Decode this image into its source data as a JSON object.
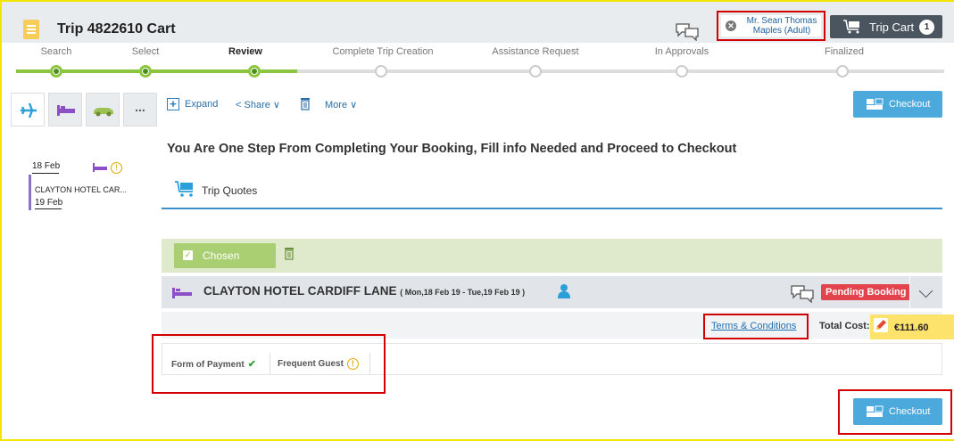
{
  "header": {
    "title": "Trip 4822610 Cart",
    "user_line1": "Mr. Sean Thomas",
    "user_line2": "Maples (Adult)",
    "cart_label": "Trip Cart",
    "cart_count": "1"
  },
  "steps": [
    {
      "label": "Search",
      "state": "done"
    },
    {
      "label": "Select",
      "state": "done"
    },
    {
      "label": "Review",
      "state": "current"
    },
    {
      "label": "Complete Trip Creation",
      "state": "todo"
    },
    {
      "label": "Assistance Request",
      "state": "todo"
    },
    {
      "label": "In Approvals",
      "state": "todo"
    },
    {
      "label": "Finalized",
      "state": "todo"
    }
  ],
  "left_panel": {
    "tabs": [
      "plane-icon",
      "hotel-icon",
      "car-icon",
      "more"
    ],
    "more_label": "...",
    "trip": {
      "start_date": "18 Feb",
      "name": "CLAYTON HOTEL CAR...",
      "end_date": "19 Feb"
    }
  },
  "toolbar": {
    "expand": "Expand",
    "share": "Share",
    "more": "More",
    "checkout": "Checkout"
  },
  "main": {
    "headline": "You Are One Step From Completing Your Booking, Fill info Needed and Proceed to Checkout",
    "quotes_tab": "Trip Quotes",
    "chosen_label": "Chosen",
    "hotel_name": "CLAYTON HOTEL CARDIFF LANE",
    "hotel_dates": "( Mon,18 Feb 19 - Tue,19 Feb 19 )",
    "status": "Pending Booking",
    "terms": "Terms & Conditions",
    "total_label": "Total Cost:",
    "total_value": "€111.60",
    "form_tabs": {
      "payment": "Form of Payment",
      "frequent_guest": "Frequent Guest"
    },
    "bottom_checkout": "Checkout"
  },
  "colors": {
    "accent": "#4ba9dc",
    "progress": "#8cc63f",
    "hotel": "#8c4fc6",
    "pending": "#e2434c",
    "highlight": "#d20000"
  }
}
